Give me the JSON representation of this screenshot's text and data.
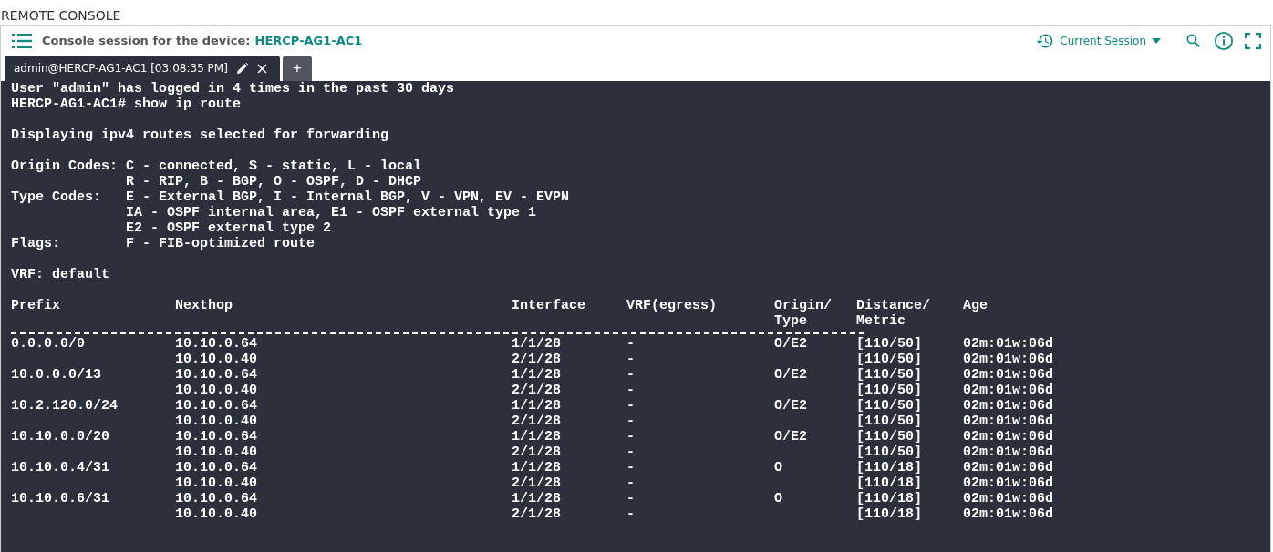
{
  "page_title": "REMOTE CONSOLE",
  "panel": {
    "title": "Console session for the device:",
    "device": "HERCP-AG1-AC1",
    "session_selector": "Current Session"
  },
  "tabs": [
    {
      "label": "admin@HERCP-AG1-AC1 [03:08:35 PM]",
      "selected": true
    }
  ],
  "new_tab": "+",
  "terminal": {
    "intro": [
      "User \"admin\" has logged in 4 times in the past 30 days",
      "HERCP-AG1-AC1# show ip route"
    ],
    "heading": "Displaying ipv4 routes selected for forwarding",
    "codes": [
      {
        "label": "Origin Codes:",
        "lines": [
          "C - connected, S - static, L - local",
          "R - RIP, B - BGP, O - OSPF, D - DHCP"
        ]
      },
      {
        "label": "Type Codes:",
        "lines": [
          "E - External BGP, I - Internal BGP, V - VPN, EV - EVPN",
          "IA - OSPF internal area, E1 - OSPF external type 1",
          "E2 - OSPF external type 2"
        ]
      },
      {
        "label": "Flags:",
        "lines": [
          "F - FIB-optimized route"
        ]
      }
    ],
    "vrf": "VRF: default",
    "columns": [
      [
        "Prefix"
      ],
      [
        "Nexthop"
      ],
      [
        "Interface"
      ],
      [
        "VRF(egress)"
      ],
      [
        "Origin/",
        "Type"
      ],
      [
        "Distance/",
        "Metric"
      ],
      [
        "Age"
      ]
    ],
    "routes": [
      {
        "prefix": "0.0.0.0/0",
        "origin_type": "O/E2",
        "paths": [
          {
            "nexthop": "10.10.0.64",
            "interface": "1/1/28",
            "vrf": "-",
            "distance": "[110/50]",
            "age": "02m:01w:06d"
          },
          {
            "nexthop": "10.10.0.40",
            "interface": "2/1/28",
            "vrf": "-",
            "distance": "[110/50]",
            "age": "02m:01w:06d"
          }
        ]
      },
      {
        "prefix": "10.0.0.0/13",
        "origin_type": "O/E2",
        "paths": [
          {
            "nexthop": "10.10.0.64",
            "interface": "1/1/28",
            "vrf": "-",
            "distance": "[110/50]",
            "age": "02m:01w:06d"
          },
          {
            "nexthop": "10.10.0.40",
            "interface": "2/1/28",
            "vrf": "-",
            "distance": "[110/50]",
            "age": "02m:01w:06d"
          }
        ]
      },
      {
        "prefix": "10.2.120.0/24",
        "origin_type": "O/E2",
        "paths": [
          {
            "nexthop": "10.10.0.64",
            "interface": "1/1/28",
            "vrf": "-",
            "distance": "[110/50]",
            "age": "02m:01w:06d"
          },
          {
            "nexthop": "10.10.0.40",
            "interface": "2/1/28",
            "vrf": "-",
            "distance": "[110/50]",
            "age": "02m:01w:06d"
          }
        ]
      },
      {
        "prefix": "10.10.0.0/20",
        "origin_type": "O/E2",
        "paths": [
          {
            "nexthop": "10.10.0.64",
            "interface": "1/1/28",
            "vrf": "-",
            "distance": "[110/50]",
            "age": "02m:01w:06d"
          },
          {
            "nexthop": "10.10.0.40",
            "interface": "2/1/28",
            "vrf": "-",
            "distance": "[110/50]",
            "age": "02m:01w:06d"
          }
        ]
      },
      {
        "prefix": "10.10.0.4/31",
        "origin_type": "O",
        "paths": [
          {
            "nexthop": "10.10.0.64",
            "interface": "1/1/28",
            "vrf": "-",
            "distance": "[110/18]",
            "age": "02m:01w:06d"
          },
          {
            "nexthop": "10.10.0.40",
            "interface": "2/1/28",
            "vrf": "-",
            "distance": "[110/18]",
            "age": "02m:01w:06d"
          }
        ]
      },
      {
        "prefix": "10.10.0.6/31",
        "origin_type": "O",
        "paths": [
          {
            "nexthop": "10.10.0.64",
            "interface": "1/1/28",
            "vrf": "-",
            "distance": "[110/18]",
            "age": "02m:01w:06d"
          },
          {
            "nexthop": "10.10.0.40",
            "interface": "2/1/28",
            "vrf": "-",
            "distance": "[110/18]",
            "age": "02m:01w:06d"
          }
        ]
      }
    ]
  }
}
